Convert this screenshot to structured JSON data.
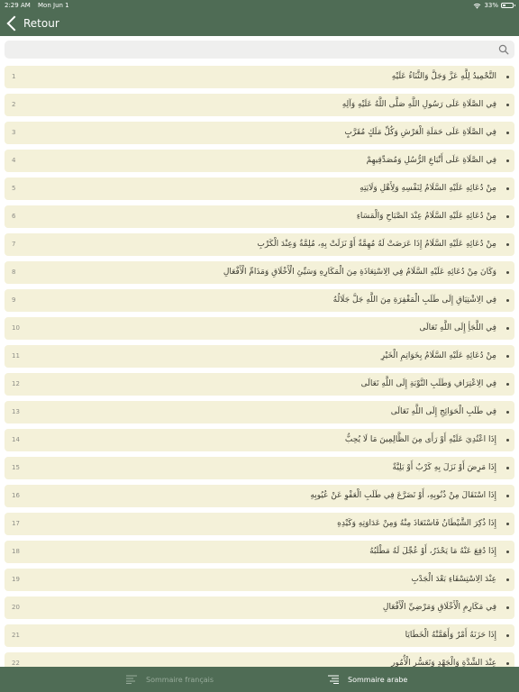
{
  "status_bar": {
    "time": "2:29 AM",
    "date": "Mon Jun 1",
    "battery": "33%",
    "battery_level": 0.33
  },
  "header": {
    "back_label": "Retour"
  },
  "search": {
    "placeholder": ""
  },
  "items": [
    {
      "num": "1",
      "text": "التَّحْمِيدُ لِلَّهِ عَزَّ وَجَلَّ وَالثَّنَاءُ عَلَيْهِ"
    },
    {
      "num": "2",
      "text": "فِي الصَّلَاةِ عَلَى رَسُولِ اللَّهِ صَلَّى اللَّهُ عَلَيْهِ وَآلِهِ"
    },
    {
      "num": "3",
      "text": "فِي الصَّلَاةِ عَلَى حَمَلَةِ الْعَرْشِ وَكُلِّ مَلَكٍ مُقَرَّبٍ"
    },
    {
      "num": "4",
      "text": "فِي الصَّلَاةِ عَلَى أَتْبَاعِ الرُّسُلِ وَمُصَدِّقِيهِمْ"
    },
    {
      "num": "5",
      "text": "مِنْ دُعَائِهِ عَلَيْهِ السَّلَامُ لِنَفْسِهِ وَلِأَهْلِ وَلَايَتِهِ"
    },
    {
      "num": "6",
      "text": "مِنْ دُعَائِهِ عَلَيْهِ السَّلَامُ عِنْدَ الصَّبَاحِ وَالْمَسَاءِ"
    },
    {
      "num": "7",
      "text": "مِنْ دُعَائِهِ عَلَيْهِ السَّلَامُ إِذَا عَرَضَتْ لَهُ مُهِمَّةٌ أَوْ نَزَلَتْ بِهِ، مُلِمَّةٌ وَعِنْدَ الْكَرْبِ"
    },
    {
      "num": "8",
      "text": "وَكَانَ مِنْ دُعَائِهِ عَلَيْهِ السَّلَامُ فِي الِاسْتِعَاذَةِ مِنَ الْمَكَارِهِ وَسَيِّئِ الْأَخْلَاقِ وَمَذَامِّ الْأَفْعَالِ"
    },
    {
      "num": "9",
      "text": "فِي الِاشْتِيَاقِ إِلَى طَلَبِ الْمَغْفِرَةِ مِنَ اللَّهِ جَلَّ جَلَالُهُ"
    },
    {
      "num": "10",
      "text": "فِي اللَّجَأِ إِلَى اللَّهِ تَعَالَى"
    },
    {
      "num": "11",
      "text": "مِنْ دُعَائِهِ عَلَيْهِ السَّلَامُ بِخَوَاتِمِ الْخَيْرِ"
    },
    {
      "num": "12",
      "text": "فِي الِاعْتِرَافِ وَطَلَبِ التَّوْبَةِ إِلَى اللَّهِ تَعَالَى"
    },
    {
      "num": "13",
      "text": "فِي طَلَبِ الْحَوَائِجِ إِلَى اللَّهِ تَعَالَى"
    },
    {
      "num": "14",
      "text": "إِذَا اعْتُدِيَ عَلَيْهِ أَوْ رَأَى مِنَ الظَّالِمِينَ مَا لَا يُحِبُّ"
    },
    {
      "num": "15",
      "text": "إِذَا مَرِضَ أَوْ نَزَلَ بِهِ كَرْبٌ أَوْ بَلِيَّةٌ"
    },
    {
      "num": "16",
      "text": "إِذَا اسْتَقَالَ مِنْ ذُنُوبِهِ، أَوْ تَضَرَّعَ فِي طَلَبِ الْعَفْوِ عَنْ عُيُوبِهِ"
    },
    {
      "num": "17",
      "text": "إِذَا ذُكِرَ الشَّيْطَانُ فَاسْتَعَاذَ مِنْهُ وَمِنْ عَدَاوَتِهِ وَكَيْدِهِ"
    },
    {
      "num": "18",
      "text": "إِذَا دُفِعَ عَنْهُ مَا يَحْذَرُ، أَوْ عُجِّلَ لَهُ مَطْلَبُهُ"
    },
    {
      "num": "19",
      "text": "عِنْدَ الِاسْتِسْقَاءِ بَعْدَ الْجَدْبِ"
    },
    {
      "num": "20",
      "text": "فِي مَكَارِمِ الْأَخْلَاقِ وَمَرْضِيِّ الْأَفْعَالِ"
    },
    {
      "num": "21",
      "text": "إِذَا حَزَنَهُ أَمْرٌ وَأَهَمَّتْهُ الْخَطَايَا"
    },
    {
      "num": "22",
      "text": "عِنْدَ الشِّدَّةِ وَالْجَهْدِ وَتَعَسُّرِ الْأُمُورِ"
    }
  ],
  "tabs": [
    {
      "label": "Sommaire français",
      "icon": "list-icon",
      "active": false
    },
    {
      "label": "Sommaire arabe",
      "icon": "list-icon",
      "active": true
    }
  ],
  "colors": {
    "header": "#4f6c55",
    "item_background": "#f4f1d9",
    "search_background": "#efefee",
    "tab_inactive": "#98ab9b",
    "tab_active": "#ffffff"
  }
}
